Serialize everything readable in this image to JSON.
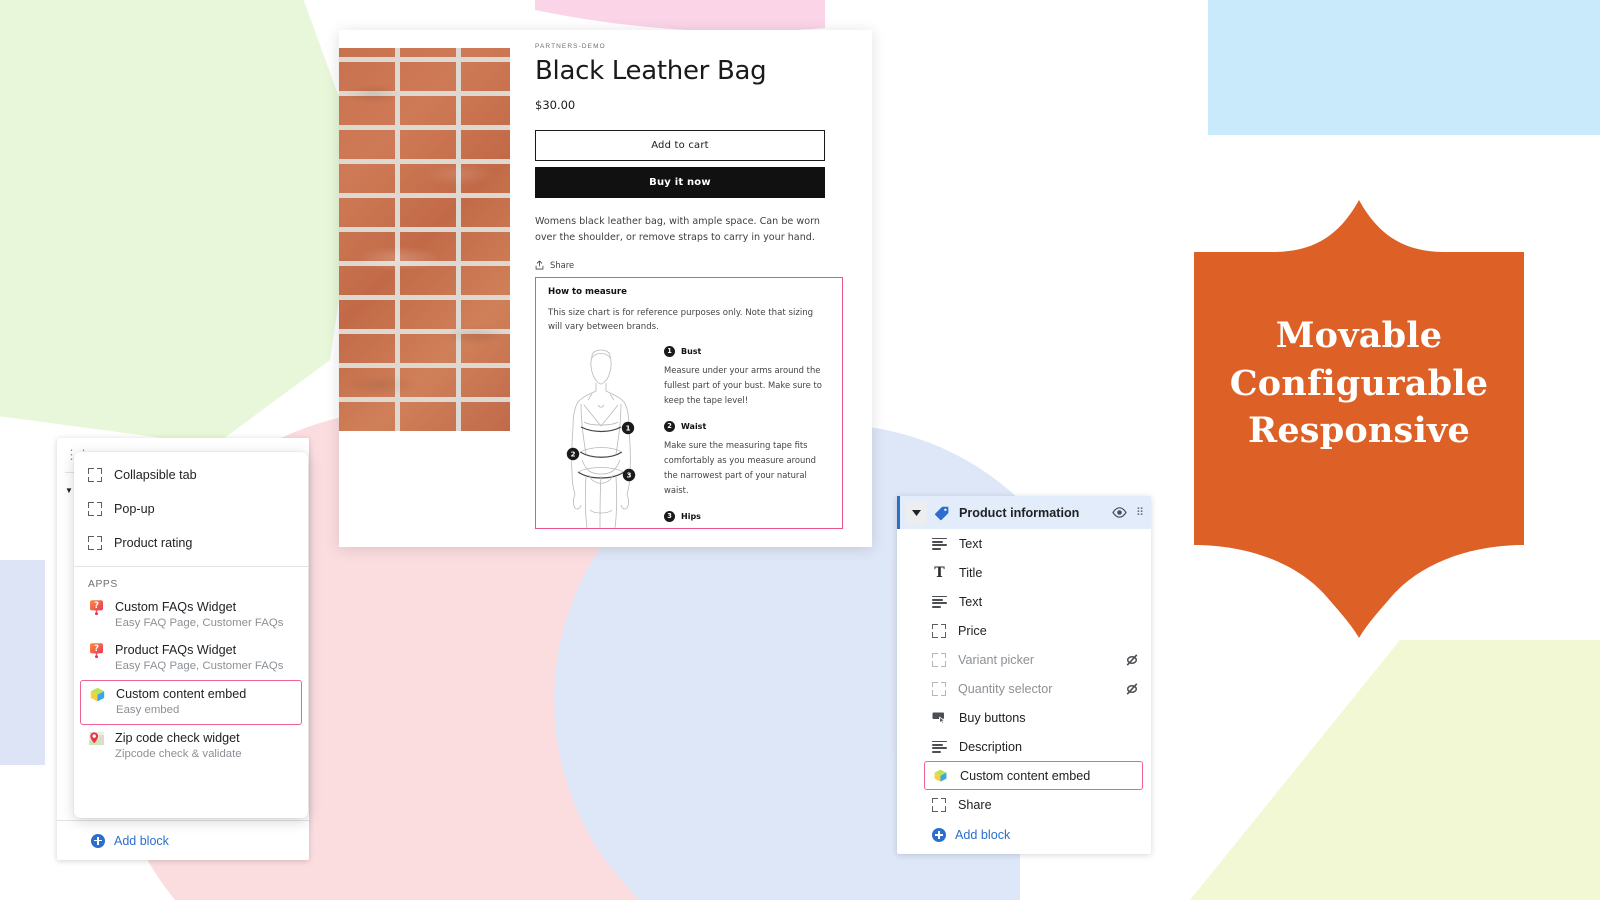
{
  "colors": {
    "accent_pink": "#f06292",
    "link_blue": "#2c6ecb",
    "shield_orange": "#dd6027",
    "bg_green": "#e8f7d9",
    "bg_blue": "#c9eafb",
    "bg_pink": "#f9d9de",
    "bg_lavender": "#f5e3f4",
    "bg_periwinkle": "#dde4f6",
    "bg_lemon": "#f2f8d4"
  },
  "badge": {
    "lines": [
      "Movable",
      "Configurable",
      "Responsive"
    ]
  },
  "storefront": {
    "vendor": "PARTNERS-DEMO",
    "title": "Black Leather Bag",
    "price": "$30.00",
    "add_to_cart_label": "Add to cart",
    "buy_now_label": "Buy it now",
    "description": "Womens black leather bag, with ample space. Can be worn over the shoulder, or remove straps to carry in your hand.",
    "share_label": "Share",
    "share_icon": "share-icon",
    "product_image_alt": "brick-wall-photo",
    "embed": {
      "heading": "How to measure",
      "intro": "This size chart is for reference purposes only. Note that sizing will vary between brands.",
      "figure_alt": "female-body-measurement-diagram",
      "measurements": [
        {
          "number": "1",
          "title": "Bust",
          "body": "Measure under your arms around the fullest part of your bust. Make sure to keep the tape level!"
        },
        {
          "number": "2",
          "title": "Waist",
          "body": "Make sure the measuring tape fits comfortably as you measure around the narrowest part of your natural waist."
        },
        {
          "number": "3",
          "title": "Hips",
          "body": ""
        }
      ]
    }
  },
  "block_picker": {
    "standard_blocks": [
      {
        "label": "Collapsible tab",
        "icon": "bracket-icon"
      },
      {
        "label": "Pop-up",
        "icon": "bracket-icon"
      },
      {
        "label": "Product rating",
        "icon": "bracket-icon"
      }
    ],
    "apps_section_label": "APPS",
    "apps": [
      {
        "name": "Custom FAQs Widget",
        "subtitle": "Easy FAQ Page, Customer FAQs",
        "icon": "faq-badge-icon",
        "selected": false
      },
      {
        "name": "Product FAQs Widget",
        "subtitle": "Easy FAQ Page, Customer FAQs",
        "icon": "faq-badge-icon",
        "selected": false
      },
      {
        "name": "Custom content embed",
        "subtitle": "Easy embed",
        "icon": "cube-icon",
        "selected": true
      },
      {
        "name": "Zip code check widget",
        "subtitle": "Zipcode check & validate",
        "icon": "map-pin-icon",
        "selected": false
      }
    ]
  },
  "editor_panel": {
    "add_block_label": "Add block",
    "add_block_icon": "plus-circle-icon"
  },
  "blocks_panel": {
    "header": {
      "title": "Product information",
      "tag_icon": "tag-icon",
      "caret_icon": "chevron-down-icon",
      "eye_icon": "eye-icon",
      "drag_icon": "drag-handle-icon"
    },
    "rows": [
      {
        "label": "Text",
        "icon": "text-lines-icon",
        "dimmed": false,
        "hidden": false,
        "highlight": false
      },
      {
        "label": "Title",
        "icon": "title-T-icon",
        "dimmed": false,
        "hidden": false,
        "highlight": false
      },
      {
        "label": "Text",
        "icon": "text-lines-icon",
        "dimmed": false,
        "hidden": false,
        "highlight": false
      },
      {
        "label": "Price",
        "icon": "bracket-icon",
        "dimmed": false,
        "hidden": false,
        "highlight": false
      },
      {
        "label": "Variant picker",
        "icon": "bracket-icon",
        "dimmed": true,
        "hidden": true,
        "highlight": false
      },
      {
        "label": "Quantity selector",
        "icon": "bracket-icon",
        "dimmed": true,
        "hidden": true,
        "highlight": false
      },
      {
        "label": "Buy buttons",
        "icon": "buy-button-icon",
        "dimmed": false,
        "hidden": false,
        "highlight": false
      },
      {
        "label": "Description",
        "icon": "text-lines-icon",
        "dimmed": false,
        "hidden": false,
        "highlight": false
      },
      {
        "label": "Custom content embed",
        "icon": "cube-icon",
        "dimmed": false,
        "hidden": false,
        "highlight": true
      },
      {
        "label": "Share",
        "icon": "bracket-icon",
        "dimmed": false,
        "hidden": false,
        "highlight": false
      }
    ],
    "add_block_label": "Add block",
    "add_block_icon": "plus-circle-icon"
  }
}
